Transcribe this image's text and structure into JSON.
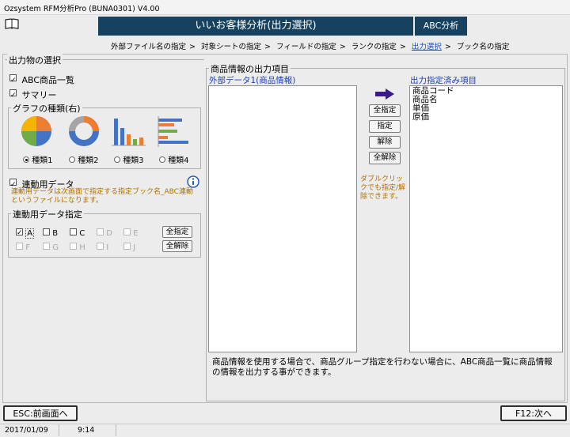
{
  "window": {
    "title": "Ozsystem RFM分析Pro (BUNA0301)   V4.00"
  },
  "header": {
    "title": "いいお客様分析(出力選択)",
    "mode": "ABC分析"
  },
  "breadcrumb": {
    "steps": [
      "外部ファイル名の指定",
      "対象シートの指定",
      "フィールドの指定",
      "ランクの指定",
      "出力選択",
      "ブック名の指定"
    ]
  },
  "output_selection": {
    "legend": "出力物の選択",
    "abc_list": {
      "label": "ABC商品一覧",
      "checked": true
    },
    "summary": {
      "label": "サマリー",
      "checked": true
    },
    "graph_type": {
      "legend": "グラフの種類(右)",
      "options": [
        "種類1",
        "種類2",
        "種類3",
        "種類4"
      ],
      "selected": "種類1"
    },
    "link_data": {
      "label": "連動用データ",
      "checked": true,
      "note": "連動用データは次画面で指定する指定ブック名_ABC連動というファイルになります。"
    },
    "link_spec": {
      "legend": "連動用データ指定",
      "row1": [
        "A",
        "B",
        "C",
        "D",
        "E"
      ],
      "row2": [
        "F",
        "G",
        "H",
        "I",
        "J"
      ],
      "checked": [
        "A"
      ],
      "disabled": [
        "D",
        "E",
        "F",
        "G",
        "H",
        "I",
        "J"
      ],
      "select_all": "全指定",
      "clear_all": "全解除"
    }
  },
  "product_output": {
    "legend": "商品情報の出力項目",
    "source_label": "外部データ1(商品情報)",
    "source_items": [],
    "buttons": {
      "select_all": "全指定",
      "select": "指定",
      "remove": "解除",
      "remove_all": "全解除"
    },
    "hint": "ダブルクリックでも指定/解除できます。",
    "target_label": "出力指定済み項目",
    "target_items": [
      "商品コード",
      "商品名",
      "単価",
      "原価"
    ],
    "description": "商品情報を使用する場合で、商品グループ指定を行わない場合に、ABC商品一覧に商品情報の情報を出力する事ができます。"
  },
  "footer": {
    "back": "ESC:前画面へ",
    "next": "F12:次へ"
  },
  "status": {
    "date": "2017/01/09",
    "time": "9:14"
  },
  "colors": {
    "header_bg": "#16425f",
    "hint_text": "#b07000",
    "arrow": "#3a1a8a"
  }
}
